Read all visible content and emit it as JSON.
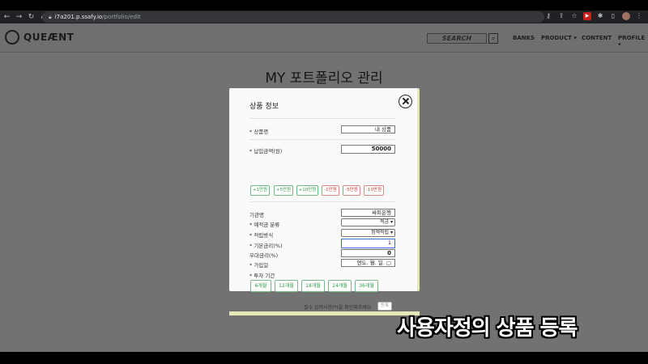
{
  "browser": {
    "url_host": "i7a201.p.ssafy.io",
    "url_path": "/portfolio/edit"
  },
  "header": {
    "logo": "QUEÆNT",
    "search_placeholder": "SEARCH",
    "nav": [
      "BANKS",
      "PRODUCT ▾",
      "CONTENT",
      "PROFILE ▾"
    ]
  },
  "page": {
    "title": "MY 포트폴리오 관리"
  },
  "modal": {
    "title": "상품 정보",
    "product_name_label": "* 상품명",
    "product_name_value": "내 상품",
    "payment_label": "* 납입금액(원)",
    "payment_value": "50000",
    "amount_buttons": [
      "+1만원",
      "+5만원",
      "+10만원",
      "-1만원",
      "-5만원",
      "-10만원"
    ],
    "institution_label": "기관명",
    "institution_value": "싸피은행",
    "type_label": "* 예적금 분류",
    "type_value": "적금 ▾",
    "method_label": "* 적립방식",
    "method_value": "정액적립 ▾",
    "base_rate_label": "* 기본금리(%)",
    "base_rate_value": "1",
    "bonus_rate_label": "우대금리(%)",
    "bonus_rate_value": "0",
    "join_date_label": "* 가입일",
    "join_date_value": "연도. 월. 일. ▢",
    "period_label": "* 투자 기간",
    "period_buttons": [
      "6개월",
      "12개월",
      "18개월",
      "24개월",
      "36개월"
    ],
    "footer_note": "필수 입력사항(*)을 확인해주세요.",
    "submit_label": "등록"
  },
  "caption": "사용자정의 상품 등록"
}
